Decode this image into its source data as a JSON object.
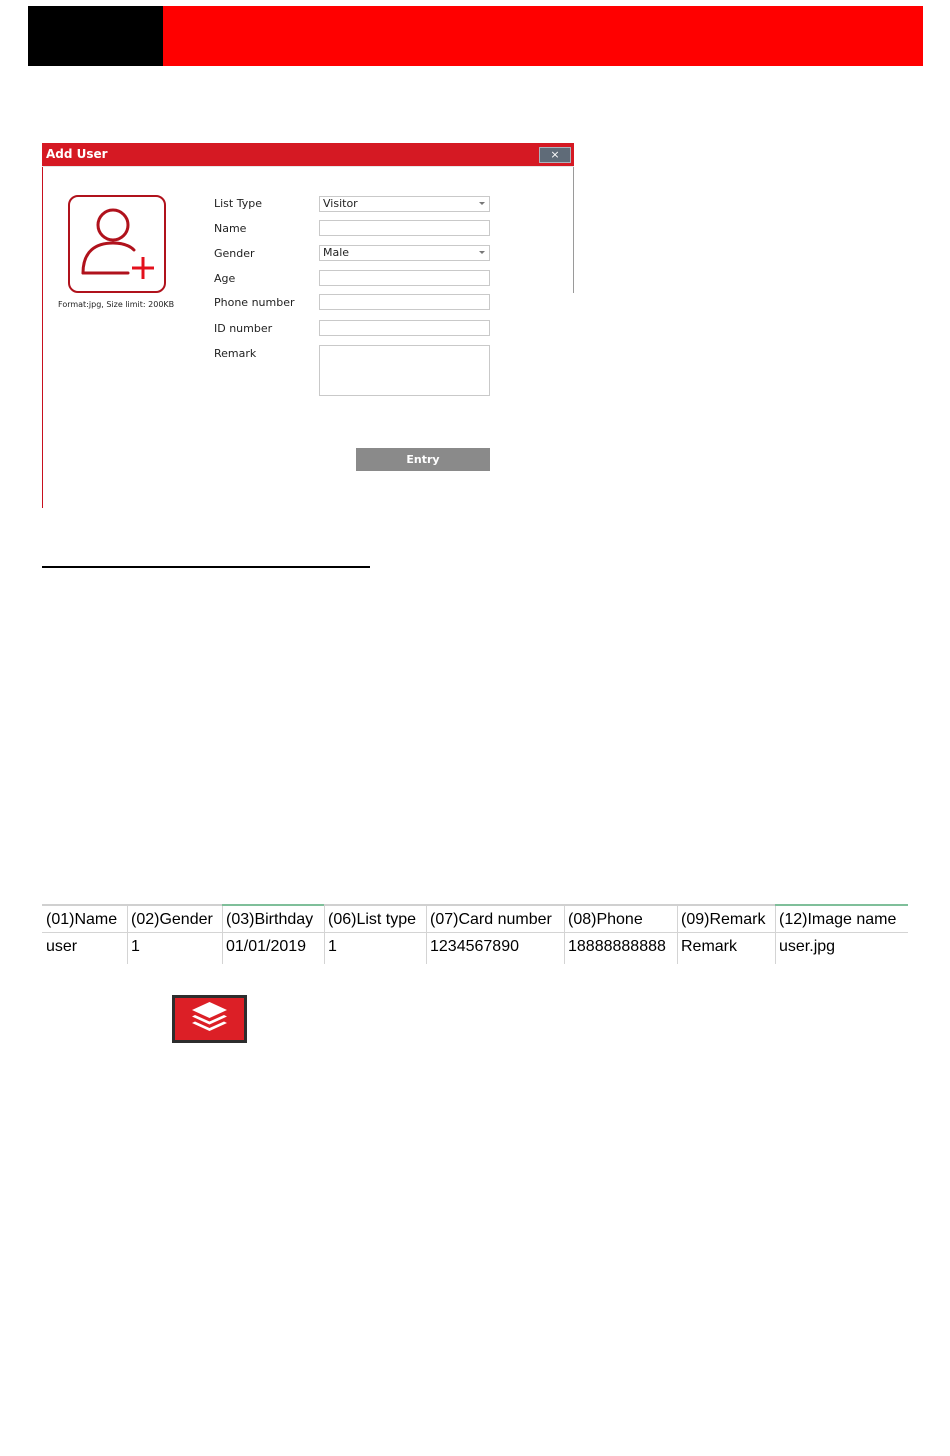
{
  "dialog": {
    "title": "Add User",
    "close_label": "×",
    "format_note": "Format:jpg, Size limit: 200KB",
    "labels": {
      "list_type": "List Type",
      "name": "Name",
      "gender": "Gender",
      "age": "Age",
      "phone": "Phone number",
      "id_number": "ID number",
      "remark": "Remark"
    },
    "values": {
      "list_type": "Visitor",
      "name": "",
      "gender": "Male",
      "age": "",
      "phone": "",
      "id_number": "",
      "remark": ""
    },
    "entry_label": "Entry",
    "icons": {
      "avatar": "add-user-icon",
      "close": "close-icon",
      "dropdown": "chevron-down-icon"
    },
    "colors": {
      "title_bar": "#d51923",
      "accent": "#b0121c",
      "entry_button": "#8a8a8a"
    }
  },
  "spreadsheet": {
    "headers": [
      "(01)Name",
      "(02)Gender",
      "(03)Birthday",
      "(06)List type",
      "(07)Card number",
      "(08)Phone",
      "(09)Remark",
      "(12)Image name"
    ],
    "row": [
      "user",
      "1",
      "01/01/2019",
      "1",
      "1234567890",
      "18888888888",
      "Remark",
      "user.jpg"
    ]
  },
  "layers_button": {
    "icon": "layers-icon",
    "color": "#dc1f26"
  },
  "page_header": {
    "colors": [
      "#000000",
      "#ff0000"
    ]
  }
}
